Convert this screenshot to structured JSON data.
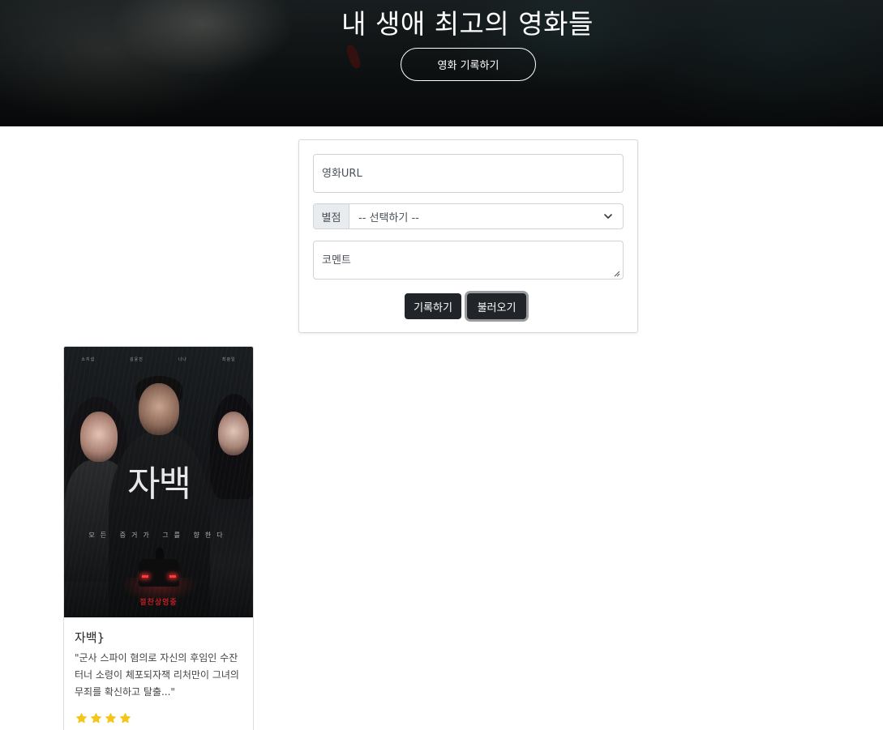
{
  "header": {
    "title": "내 생애 최고의 영화들",
    "record_button": "영화 기록하기"
  },
  "form": {
    "url_placeholder": "영화URL",
    "rating_label": "별점",
    "rating_selected": "-- 선택하기 --",
    "comment_placeholder": "코멘트",
    "submit_button": "기록하기",
    "load_button": "불러오기"
  },
  "cards": [
    {
      "poster": {
        "names": [
          "소지섭",
          "김윤진",
          "나나",
          "최광일"
        ],
        "title": "자백",
        "tagline": "모든 증거가 그를 향한다",
        "release": "절찬상영중"
      },
      "title": "자백}",
      "description": "\"군사 스파이 혐의로 자신의 후임인 수잔 터너 소령이 체포되자잭 리처만이 그녀의 무죄를 확신하고 탈출...\"",
      "star_count": 4,
      "star_color": "#f5c518"
    }
  ]
}
